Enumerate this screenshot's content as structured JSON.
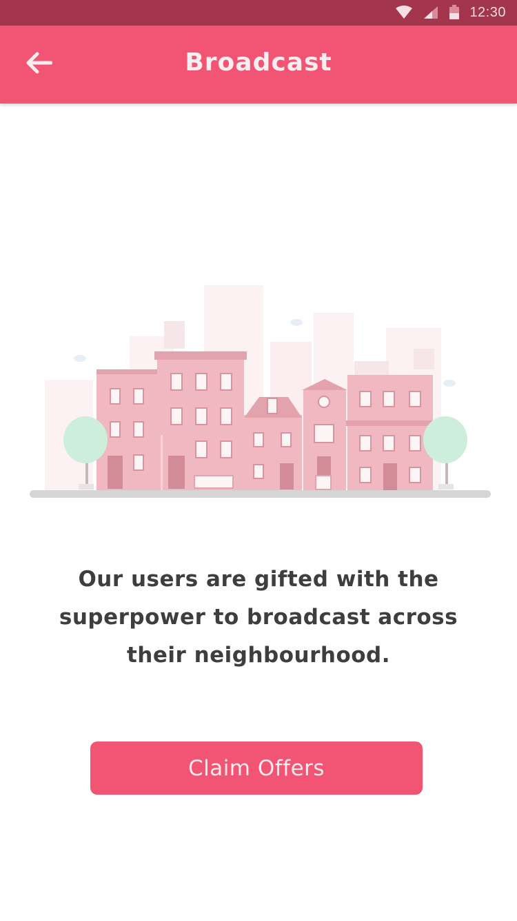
{
  "status_bar": {
    "time": "12:30",
    "icons": [
      "wifi-icon",
      "cell-signal-icon",
      "battery-icon"
    ],
    "color": "#a3354c"
  },
  "app_bar": {
    "title": "Broadcast",
    "back_icon": "arrow-left-icon",
    "color": "#f25574"
  },
  "illustration": {
    "name": "neighbourhood-buildings-illustration"
  },
  "message": {
    "text": "Our users are gifted with the superpower to broadcast across their neighbourhood."
  },
  "cta": {
    "label": "Claim Offers",
    "color": "#f25574"
  }
}
